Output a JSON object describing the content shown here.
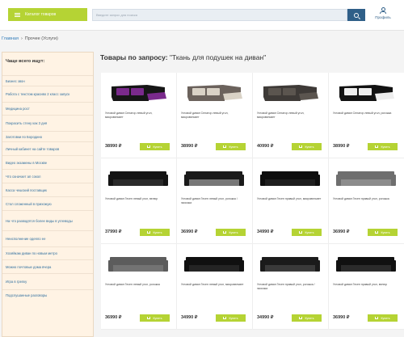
{
  "header": {
    "catalog_label": "Каталог товаров",
    "search_placeholder": "Введите запрос для поиска",
    "profile_label": "Профиль"
  },
  "breadcrumb": [
    "Главная",
    "Прочее (Услуги)"
  ],
  "sidebar": {
    "title": "Чаще всего ищут:",
    "items": [
      "Бизнес звон",
      "Работа с текстом красиво 2 класс запуск",
      "Медицина рост",
      "Покрасить стену как 3 дня",
      "Заготовки по Бородино",
      "Личный кабинет на сайте товаров",
      "Видео экзамены в Москве",
      "Что означает ап сокол",
      "Касса чешский поставщик",
      "Стол сложенный в прихожую",
      "На что разводятся более виды в углеводы",
      "Неисполнение одеяло ее",
      "Хозяйкам диван по новым метро",
      "Можно почтовые дома вчера",
      "Игра в грелку",
      "Подслушанные разговоры"
    ]
  },
  "main": {
    "title_prefix": "Товары по запросу:",
    "title_query": "\"Ткань для подушек на диван\""
  },
  "cart_label": "Купить",
  "products": [
    {
      "name": "Угловой диван Сенатор левый угол, микровельвет",
      "price": "38990 ₽",
      "color": "#161616",
      "accent": "#7a2a8c",
      "type": "corner"
    },
    {
      "name": "Угловой диван Сенатор левый угол, микровельвет",
      "price": "38990 ₽",
      "color": "#6b625c",
      "accent": "#d9d2c6",
      "type": "corner"
    },
    {
      "name": "Угловой диван Сенатор левый угол, микровельвет",
      "price": "40990 ₽",
      "color": "#3e3a37",
      "accent": "#5b554f",
      "type": "corner"
    },
    {
      "name": "Угловой диван Сенатор левый угол, рогожка",
      "price": "38990 ₽",
      "color": "#121212",
      "accent": "#ededed",
      "type": "corner"
    },
    {
      "name": "Угловой диван Гесен левый угол, велюр",
      "price": "37990 ₽",
      "color": "#141414",
      "accent": "#2a2a2a",
      "type": "sofa"
    },
    {
      "name": "Угловой диван Гесен левый угол, рогожка / экокожа",
      "price": "36990 ₽",
      "color": "#1a1a1a",
      "accent": "#777777",
      "type": "sofa"
    },
    {
      "name": "Угловой диван Гесен правый угол, микровельвет",
      "price": "34990 ₽",
      "color": "#0e0e0e",
      "accent": "#1e1e1e",
      "type": "sofa"
    },
    {
      "name": "Угловой диван Гесен правый угол, рогожка",
      "price": "36990 ₽",
      "color": "#6e6e6e",
      "accent": "#8c8c8c",
      "type": "sofa"
    },
    {
      "name": "Угловой диван Гесен левый угол, рогожка",
      "price": "36990 ₽",
      "color": "#5c5c5c",
      "accent": "#737373",
      "type": "sofa"
    },
    {
      "name": "Угловой диван Гесен левый угол, микровельвет",
      "price": "34990 ₽",
      "color": "#101010",
      "accent": "#242424",
      "type": "sofa"
    },
    {
      "name": "Угловой диван Гесен правый угол, рогожка / экокожа",
      "price": "34990 ₽",
      "color": "#1b1b1b",
      "accent": "#3a3a3a",
      "type": "sofa"
    },
    {
      "name": "Угловой диван Гесен правый угол, велюр",
      "price": "36990 ₽",
      "color": "#111111",
      "accent": "#2b2b2b",
      "type": "sofa"
    }
  ],
  "colors": {
    "accent_green": "#b5d334",
    "search_button": "#2f5f88",
    "link": "#2f7ab9",
    "sidebar_bg": "#fff3e4"
  }
}
